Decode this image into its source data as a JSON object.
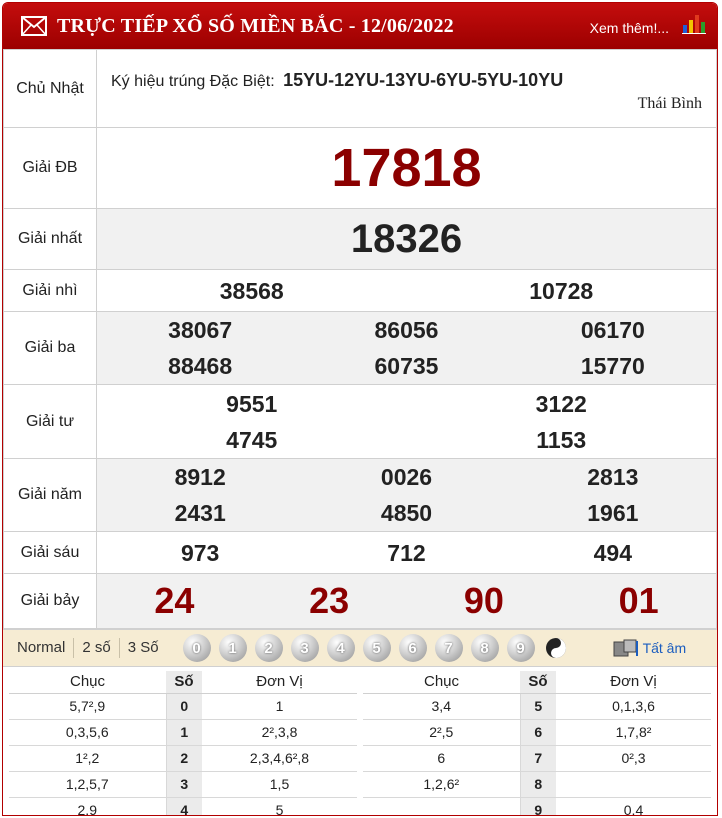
{
  "header": {
    "title": "TRỰC TIẾP XỔ SỐ MIỀN BẮC - 12/06/2022",
    "more_link": "Xem thêm!..."
  },
  "info": {
    "day": "Chủ Nhật",
    "kyhieu_label": "Ký hiệu trúng Đặc Biệt:",
    "kyhieu_code": "15YU-12YU-13YU-6YU-5YU-10YU",
    "province": "Thái Bình"
  },
  "prizes": [
    {
      "label": "Giải ĐB",
      "numbers": [
        "17818"
      ]
    },
    {
      "label": "Giải nhất",
      "numbers": [
        "18326"
      ]
    },
    {
      "label": "Giải nhì",
      "numbers": [
        "38568",
        "10728"
      ]
    },
    {
      "label": "Giải ba",
      "numbers": [
        "38067",
        "86056",
        "06170",
        "88468",
        "60735",
        "15770"
      ]
    },
    {
      "label": "Giải tư",
      "numbers": [
        "9551",
        "3122",
        "4745",
        "1153"
      ]
    },
    {
      "label": "Giải năm",
      "numbers": [
        "8912",
        "0026",
        "2813",
        "2431",
        "4850",
        "1961"
      ]
    },
    {
      "label": "Giải sáu",
      "numbers": [
        "973",
        "712",
        "494"
      ]
    },
    {
      "label": "Giải bảy",
      "numbers": [
        "24",
        "23",
        "90",
        "01"
      ]
    }
  ],
  "toolbar": {
    "modes": [
      "Normal",
      "2 số",
      "3 Số"
    ],
    "digits": [
      "0",
      "1",
      "2",
      "3",
      "4",
      "5",
      "6",
      "7",
      "8",
      "9"
    ],
    "all_label": "Tất âm"
  },
  "loto": {
    "headers": [
      "Chục",
      "Số",
      "Đơn Vị"
    ],
    "left": [
      {
        "chuc": "5,7²,9",
        "so": "0",
        "donvi": "1"
      },
      {
        "chuc": "0,3,5,6",
        "so": "1",
        "donvi": "2²,3,8"
      },
      {
        "chuc": "1²,2",
        "so": "2",
        "donvi": "2,3,4,6²,8"
      },
      {
        "chuc": "1,2,5,7",
        "so": "3",
        "donvi": "1,5"
      },
      {
        "chuc": "2,9",
        "so": "4",
        "donvi": "5"
      }
    ],
    "right": [
      {
        "chuc": "3,4",
        "so": "5",
        "donvi": "0,1,3,6"
      },
      {
        "chuc": "2²,5",
        "so": "6",
        "donvi": "1,7,8²"
      },
      {
        "chuc": "6",
        "so": "7",
        "donvi": "0²,3"
      },
      {
        "chuc": "1,2,6²",
        "so": "8",
        "donvi": ""
      },
      {
        "chuc": "",
        "so": "9",
        "donvi": "0,4"
      }
    ]
  }
}
